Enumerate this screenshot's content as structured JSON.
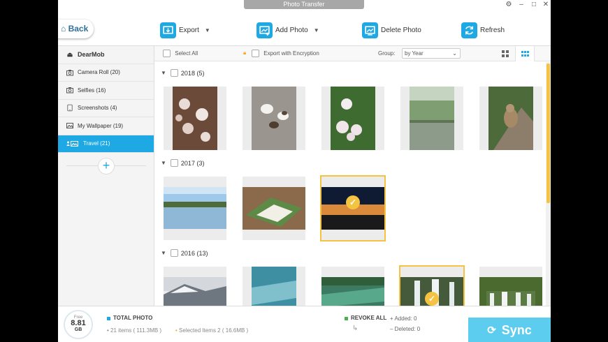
{
  "window": {
    "title": "Photo Transfer"
  },
  "toolbar": {
    "back": "Back",
    "export": "Export",
    "add_photo": "Add Photo",
    "delete_photo": "Delete Photo",
    "refresh": "Refresh"
  },
  "sidebar": {
    "device": "DearMob",
    "items": [
      {
        "label": "Camera Roll (20)",
        "icon": "camera-icon"
      },
      {
        "label": "Selfies (16)",
        "icon": "camera-icon"
      },
      {
        "label": "Screenshots (4)",
        "icon": "phone-icon"
      },
      {
        "label": "My Wallpaper (19)",
        "icon": "image-icon"
      },
      {
        "label": "Travel (21)",
        "icon": "image-icon",
        "active": true
      }
    ]
  },
  "subbar": {
    "select_all": "Select All",
    "export_encrypt": "Export with Encryption",
    "group_label": "Group:",
    "group_value": "by Year"
  },
  "sections": [
    {
      "label": "2018 (5)"
    },
    {
      "label": "2017 (3)"
    },
    {
      "label": "2016 (13)"
    }
  ],
  "bottom": {
    "free_label": "Free",
    "free_value": "8.81",
    "free_unit": "GB",
    "total_label": "TOTAL PHOTO",
    "items_info": "21 items ( 111.3MB )",
    "selected_info": "Selected Items 2 ( 16.6MB )",
    "revoke": "REVOKE ALL",
    "added": "Added: 0",
    "deleted": "Deleted: 0",
    "sync": "Sync"
  },
  "colors": {
    "accent": "#1ea9e5",
    "selection": "#f5c342",
    "sync": "#5ccdef"
  }
}
